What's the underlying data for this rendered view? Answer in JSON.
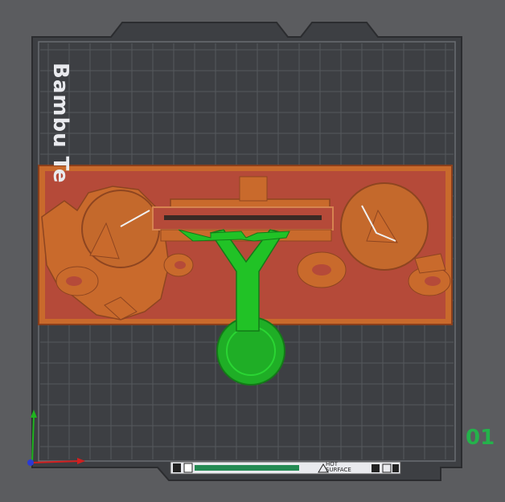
{
  "plate": {
    "brand_text": "Bambu Te",
    "plate_number": "01",
    "surface_label_line1": "HOT",
    "surface_label_line2": "SURFACE"
  },
  "colors": {
    "background": "#5b5c5f",
    "bed": "#3d3f43",
    "grid": "#55585d",
    "model_top": "#b54a39",
    "model_orange": "#c96a2c",
    "support_green": "#21c226",
    "axis_x": "#d21f1f",
    "axis_y": "#1fb51f",
    "plate_number": "#24b24b"
  },
  "icons": [
    "axis-gizmo-icon",
    "hot-surface-icon",
    "label-strip-icon"
  ]
}
